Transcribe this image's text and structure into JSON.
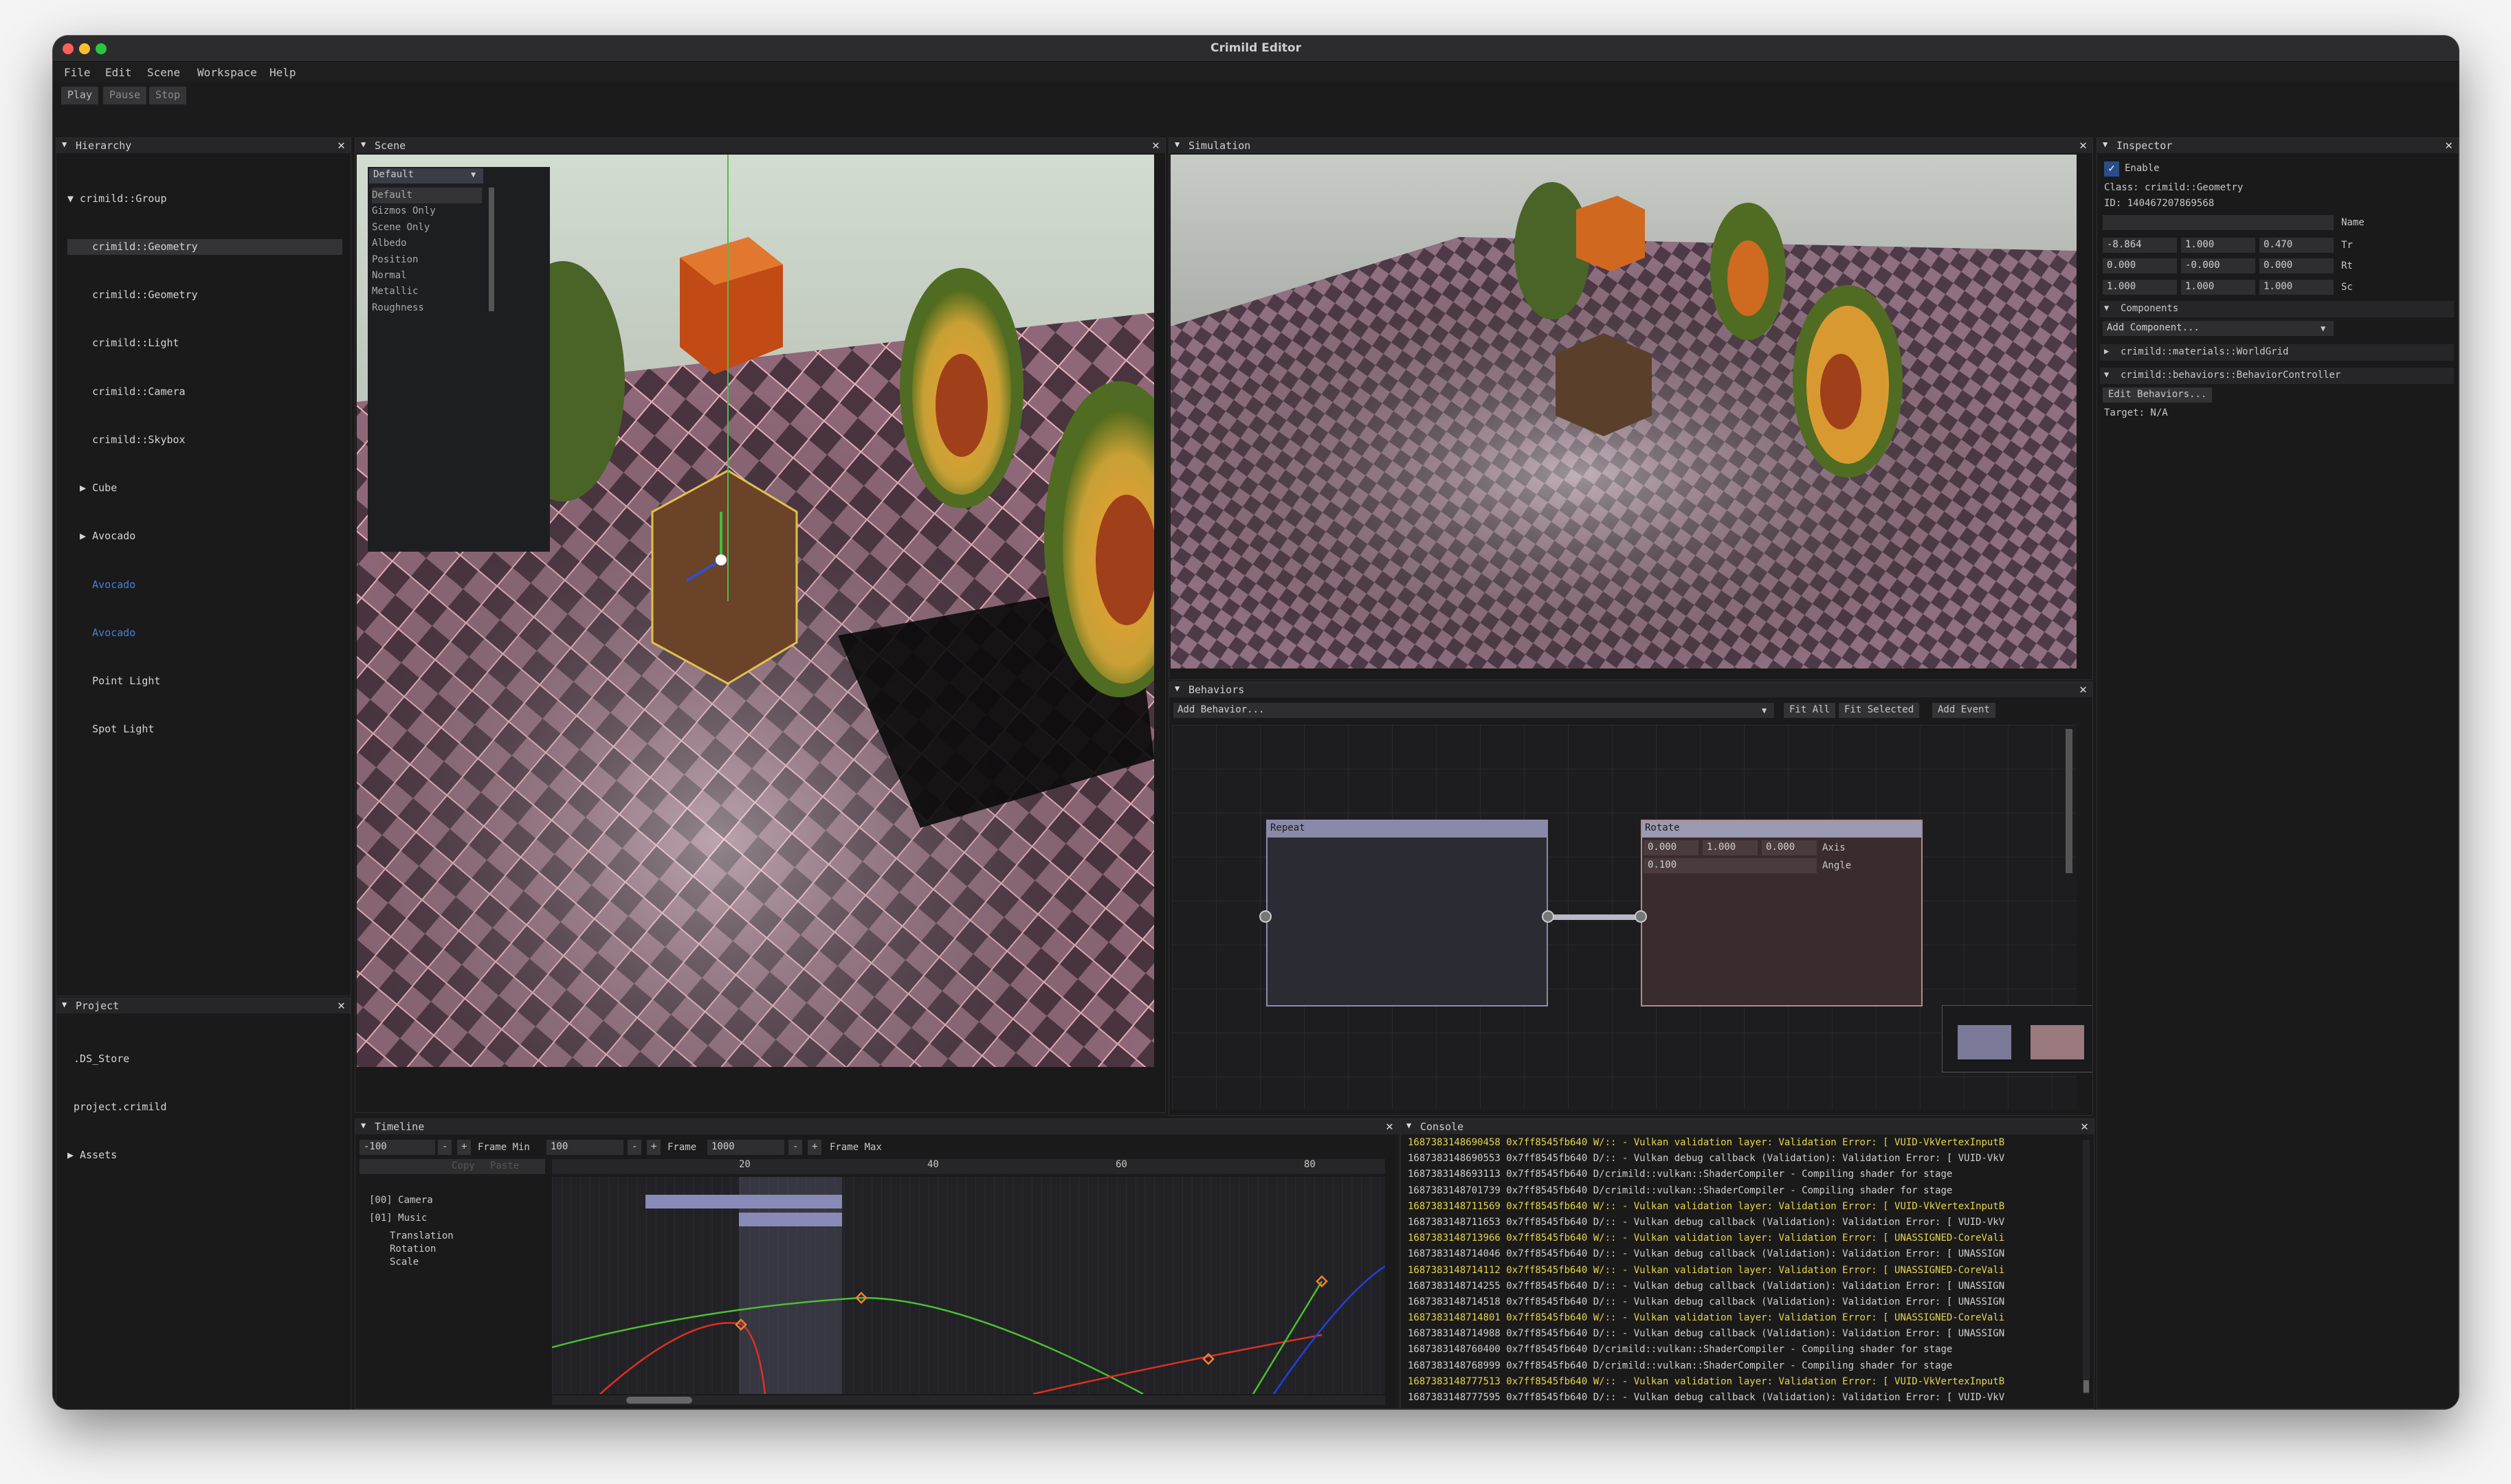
{
  "window": {
    "title": "Crimild Editor"
  },
  "menu": [
    "File",
    "Edit",
    "Scene",
    "Workspace",
    "Help"
  ],
  "toolbar": {
    "play": "Play",
    "pause": "Pause",
    "stop": "Stop"
  },
  "hierarchy": {
    "title": "Hierarchy",
    "items": [
      {
        "label": "▼ crimild::Group"
      },
      {
        "label": "    crimild::Geometry"
      },
      {
        "label": "    crimild::Geometry"
      },
      {
        "label": "    crimild::Light"
      },
      {
        "label": "    crimild::Camera"
      },
      {
        "label": "    crimild::Skybox"
      },
      {
        "label": "  ▶ Cube"
      },
      {
        "label": "  ▶ Avocado"
      },
      {
        "label": "    Avocado"
      },
      {
        "label": "    Avocado"
      },
      {
        "label": "    Point Light"
      },
      {
        "label": "    Spot Light"
      }
    ]
  },
  "project": {
    "title": "Project",
    "items": [
      " .DS_Store",
      " project.crimild",
      "▶ Assets"
    ]
  },
  "scene": {
    "title": "Scene",
    "dropdown_value": "Default",
    "options": [
      "Default",
      "Gizmos Only",
      "Scene Only",
      "Albedo",
      "Position",
      "Normal",
      "Metallic",
      "Roughness"
    ]
  },
  "simulation": {
    "title": "Simulation"
  },
  "inspector": {
    "title": "Inspector",
    "enable_label": "Enable",
    "class_text": "Class: crimild::Geometry",
    "id_text": "ID: 140467207869568",
    "name_label": "Name",
    "tr": [
      "-8.864",
      "1.000",
      "0.470"
    ],
    "tr_label": "Tr",
    "rt": [
      "0.000",
      "-0.000",
      "0.000"
    ],
    "rt_label": "Rt",
    "sc": [
      "1.000",
      "1.000",
      "1.000"
    ],
    "sc_label": "Sc",
    "components_header": "Components",
    "add_component": "Add Component...",
    "component_1": "crimild::materials::WorldGrid",
    "component_2": "crimild::behaviors::BehaviorController",
    "edit_behaviors": "Edit Behaviors...",
    "target": "Target: N/A"
  },
  "behaviors": {
    "title": "Behaviors",
    "add_behavior": "Add Behavior...",
    "fit_all": "Fit All",
    "fit_selected": "Fit Selected",
    "add_event": "Add Event",
    "node_repeat": "Repeat",
    "node_rotate": "Rotate",
    "axis": [
      "0.000",
      "1.000",
      "0.000"
    ],
    "axis_label": "Axis",
    "angle": "0.100",
    "angle_label": "Angle"
  },
  "timeline": {
    "title": "Timeline",
    "frame_min_val": "-100",
    "frame_min_label": "Frame Min",
    "frame_val": "100",
    "frame_label": "Frame",
    "frame_max_val": "1000",
    "frame_max_label": "Frame Max",
    "copy": "Copy",
    "paste": "Paste",
    "ticks": [
      "20",
      "40",
      "60",
      "80"
    ],
    "tracks": [
      "[00] Camera",
      "[01] Music"
    ],
    "subtracks": [
      "Translation",
      "Rotation",
      "Scale"
    ]
  },
  "console": {
    "title": "Console",
    "lines": [
      {
        "t": "1687383148690458 0x7ff8545fb640 W/:: - Vulkan validation layer: Validation Error: [ VUID-VkVertexInputB",
        "w": true
      },
      {
        "t": "1687383148690553 0x7ff8545fb640 D/:: - Vulkan debug callback (Validation): Validation Error: [ VUID-VkV",
        "w": false
      },
      {
        "t": "1687383148693113 0x7ff8545fb640 D/crimild::vulkan::ShaderCompiler - Compiling shader for stage",
        "w": false
      },
      {
        "t": "1687383148701739 0x7ff8545fb640 D/crimild::vulkan::ShaderCompiler - Compiling shader for stage",
        "w": false
      },
      {
        "t": "1687383148711569 0x7ff8545fb640 W/:: - Vulkan validation layer: Validation Error: [ VUID-VkVertexInputB",
        "w": true
      },
      {
        "t": "1687383148711653 0x7ff8545fb640 D/:: - Vulkan debug callback (Validation): Validation Error: [ VUID-VkV",
        "w": false
      },
      {
        "t": "1687383148713966 0x7ff8545fb640 W/:: - Vulkan validation layer: Validation Error: [ UNASSIGNED-CoreVali",
        "w": true
      },
      {
        "t": "1687383148714046 0x7ff8545fb640 D/:: - Vulkan debug callback (Validation): Validation Error: [ UNASSIGN",
        "w": false
      },
      {
        "t": "1687383148714112 0x7ff8545fb640 W/:: - Vulkan validation layer: Validation Error: [ UNASSIGNED-CoreVali",
        "w": true
      },
      {
        "t": "1687383148714255 0x7ff8545fb640 D/:: - Vulkan debug callback (Validation): Validation Error: [ UNASSIGN",
        "w": false
      },
      {
        "t": "1687383148714518 0x7ff8545fb640 D/:: - Vulkan debug callback (Validation): Validation Error: [ UNASSIGN",
        "w": false
      },
      {
        "t": "1687383148714801 0x7ff8545fb640 W/:: - Vulkan validation layer: Validation Error: [ UNASSIGNED-CoreVali",
        "w": true
      },
      {
        "t": "1687383148714988 0x7ff8545fb640 D/:: - Vulkan debug callback (Validation): Validation Error: [ UNASSIGN",
        "w": false
      },
      {
        "t": "1687383148760400 0x7ff8545fb640 D/crimild::vulkan::ShaderCompiler - Compiling shader for stage",
        "w": false
      },
      {
        "t": "1687383148768999 0x7ff8545fb640 D/crimild::vulkan::ShaderCompiler - Compiling shader for stage",
        "w": false
      },
      {
        "t": "1687383148777513 0x7ff8545fb640 W/:: - Vulkan validation layer: Validation Error: [ VUID-VkVertexInputB",
        "w": true
      },
      {
        "t": "1687383148777595 0x7ff8545fb640 D/:: - Vulkan debug callback (Validation): Validation Error: [ VUID-VkV",
        "w": false
      }
    ]
  }
}
